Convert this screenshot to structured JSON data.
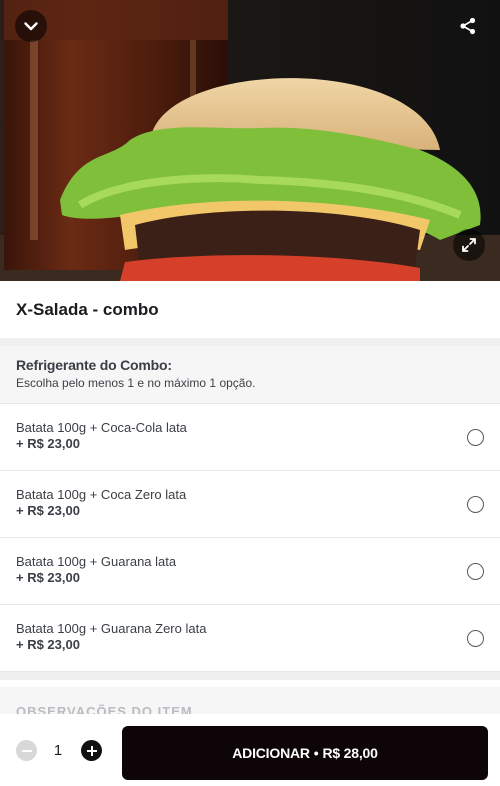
{
  "colors": {
    "accent": "#0d0508",
    "separator": "#efefef",
    "section_bg": "#f6f6f6",
    "text": "#3b4046"
  },
  "hero": {
    "back_icon": "chevron-down-icon",
    "share_icon": "share-icon",
    "expand_icon": "expand-icon"
  },
  "product": {
    "title": "X-Salada - combo"
  },
  "group": {
    "title": "Refrigerante do Combo:",
    "subtitle": "Escolha pelo menos 1 e no máximo 1 opção.",
    "options": [
      {
        "name": "Batata 100g + Coca-Cola lata",
        "price": "+ R$ 23,00"
      },
      {
        "name": "Batata 100g + Coca Zero lata",
        "price": "+ R$ 23,00"
      },
      {
        "name": "Batata 100g + Guarana lata",
        "price": "+ R$ 23,00"
      },
      {
        "name": "Batata 100g + Guarana Zero lata",
        "price": "+ R$ 23,00"
      }
    ]
  },
  "notes": {
    "label": "OBSERVAÇÕES DO ITEM"
  },
  "footer": {
    "quantity": "1",
    "add_label": "ADICIONAR",
    "separator": "•",
    "total": "R$ 28,00"
  }
}
